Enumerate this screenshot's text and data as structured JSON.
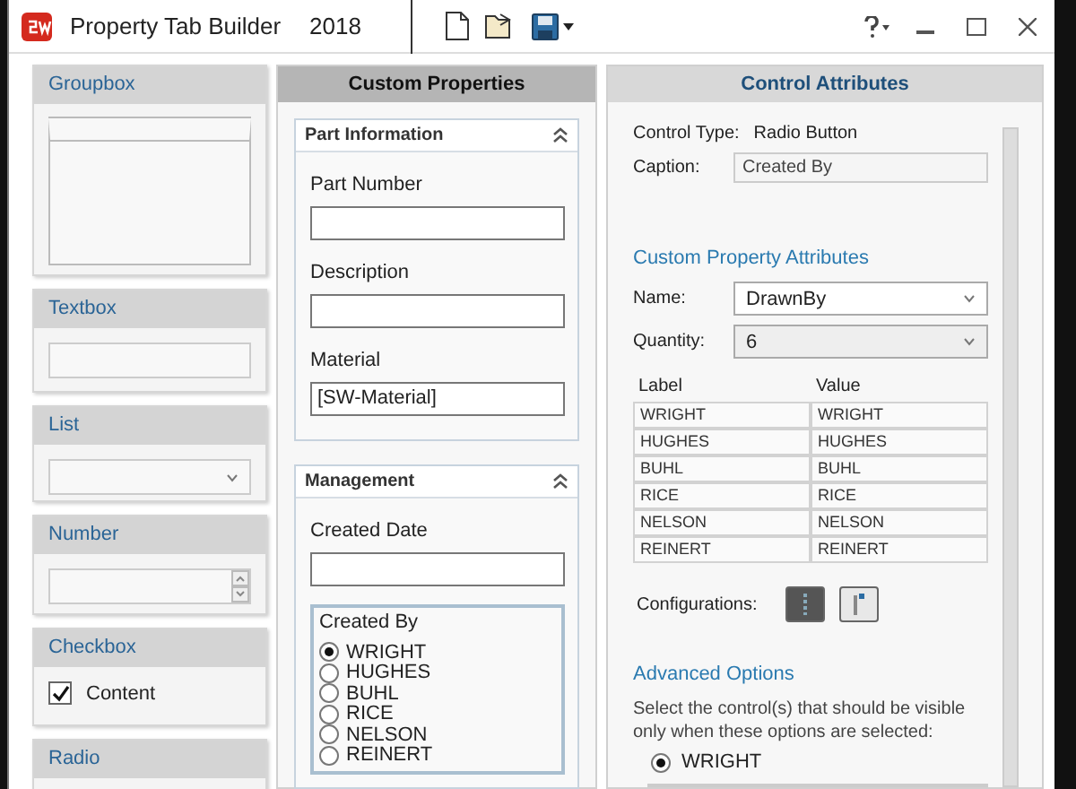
{
  "window": {
    "title": "Property Tab Builder",
    "version": "2018"
  },
  "palette": [
    {
      "kind": "groupbox",
      "label": "Groupbox"
    },
    {
      "kind": "textbox",
      "label": "Textbox"
    },
    {
      "kind": "list",
      "label": "List"
    },
    {
      "kind": "number",
      "label": "Number"
    },
    {
      "kind": "checkbox",
      "label": "Checkbox",
      "caption": "Content",
      "checked": true
    },
    {
      "kind": "radio",
      "label": "Radio"
    }
  ],
  "custom_properties": {
    "title": "Custom Properties",
    "groups": [
      {
        "title": "Part Information",
        "fields": [
          {
            "kind": "text",
            "label": "Part Number"
          },
          {
            "kind": "text",
            "label": "Description"
          },
          {
            "kind": "text",
            "label": "Material",
            "value": "[SW-Material]"
          }
        ]
      },
      {
        "title": "Management",
        "fields": [
          {
            "kind": "text",
            "label": "Created Date"
          },
          {
            "kind": "radio",
            "label": "Created By",
            "options": [
              {
                "label": "WRIGHT",
                "selected": true
              },
              {
                "label": "HUGHES",
                "selected": false
              },
              {
                "label": "BUHL",
                "selected": false
              },
              {
                "label": "RICE",
                "selected": false
              },
              {
                "label": "NELSON",
                "selected": false
              },
              {
                "label": "REINERT",
                "selected": false
              }
            ]
          }
        ]
      }
    ]
  },
  "control_attributes": {
    "title": "Control Attributes",
    "control_type_label": "Control Type:",
    "control_type": "Radio Button",
    "caption_label": "Caption:",
    "caption": "Created By",
    "section_title": "Custom Property Attributes",
    "name_label": "Name:",
    "name": "DrawnBy",
    "quantity_label": "Quantity:",
    "quantity": "6",
    "table": {
      "columns": [
        "Label",
        "Value"
      ],
      "rows": [
        [
          "WRIGHT",
          "WRIGHT"
        ],
        [
          "HUGHES",
          "HUGHES"
        ],
        [
          "BUHL",
          "BUHL"
        ],
        [
          "RICE",
          "RICE"
        ],
        [
          "NELSON",
          "NELSON"
        ],
        [
          "REINERT",
          "REINERT"
        ]
      ]
    },
    "configurations_label": "Configurations:",
    "configurations": [
      {
        "selected": true
      },
      {
        "selected": false
      }
    ],
    "advanced_title": "Advanced Options",
    "advanced_text": "Select the control(s) that should be visible only when these options are selected:",
    "advanced_options": [
      {
        "label": "WRIGHT",
        "selected": true
      }
    ]
  }
}
